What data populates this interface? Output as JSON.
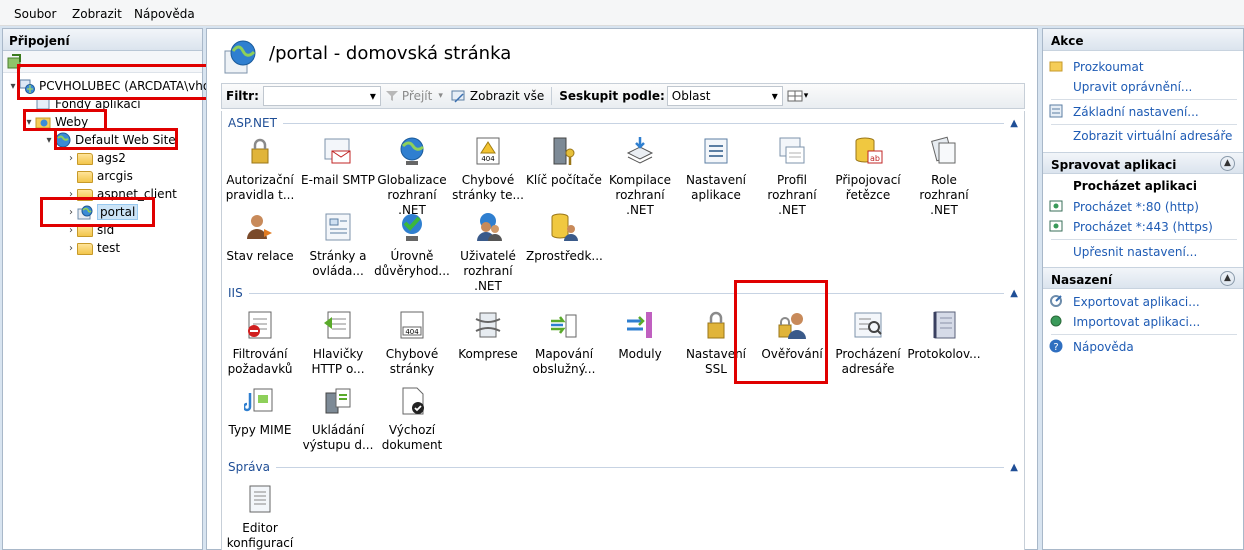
{
  "menu": [
    "Soubor",
    "Zobrazit",
    "Nápověda"
  ],
  "connections": {
    "title": "Připojení",
    "tree": {
      "server": "PCVHOLUBEC (ARCDATA\\vho",
      "app_pools": "Fondy aplikací",
      "sites": "Weby",
      "default_site": "Default Web Site",
      "children": [
        "ags2",
        "arcgis",
        "aspnet_client",
        "portal",
        "sid",
        "test"
      ]
    }
  },
  "center": {
    "title": "/portal - domovská stránka",
    "filter": {
      "label": "Filtr:",
      "go": "Přejít",
      "show_all": "Zobrazit vše",
      "group_label": "Seskupit podle:",
      "group_value": "Oblast"
    },
    "sections": [
      {
        "name": "ASP.NET",
        "items": [
          "Autorizační pravidla t...",
          "E-mail SMTP",
          "Globalizace rozhraní .NET",
          "Chybové stránky te...",
          "Klíč počítače",
          "Kompilace rozhraní .NET",
          "Nastavení aplikace",
          "Profil rozhraní .NET",
          "Připojovací řetězce",
          "Role rozhraní .NET",
          "Stav relace",
          "Stránky a ovláda...",
          "Úrovně důvěryhod...",
          "Uživatelé rozhraní .NET",
          "Zprostředk..."
        ]
      },
      {
        "name": "IIS",
        "items": [
          "Filtrování požadavků",
          "Hlavičky HTTP o...",
          "Chybové stránky",
          "Komprese",
          "Mapování obslužný...",
          "Moduly",
          "Nastavení SSL",
          "Ověřování",
          "Procházení adresáře",
          "Protokolov...",
          "Typy MIME",
          "Ukládání výstupu d...",
          "Výchozí dokument"
        ]
      },
      {
        "name": "Správa",
        "items": [
          "Editor konfigurací"
        ]
      }
    ]
  },
  "actions": {
    "title": "Akce",
    "top": [
      "Prozkoumat",
      "Upravit oprávnění...",
      "Základní nastavení...",
      "Zobrazit virtuální adresáře"
    ],
    "manage": {
      "title": "Spravovat aplikaci",
      "browse_title": "Procházet aplikaci",
      "links": [
        "Procházet *:80 (http)",
        "Procházet *:443 (https)",
        "Upřesnit nastavení..."
      ]
    },
    "deploy": {
      "title": "Nasazení",
      "links": [
        "Exportovat aplikaci...",
        "Importovat aplikaci...",
        "Nápověda"
      ]
    }
  },
  "colors": {
    "accent_link": "#1e5bb4",
    "highlight": "#e00000",
    "section": "#1f4e96"
  }
}
